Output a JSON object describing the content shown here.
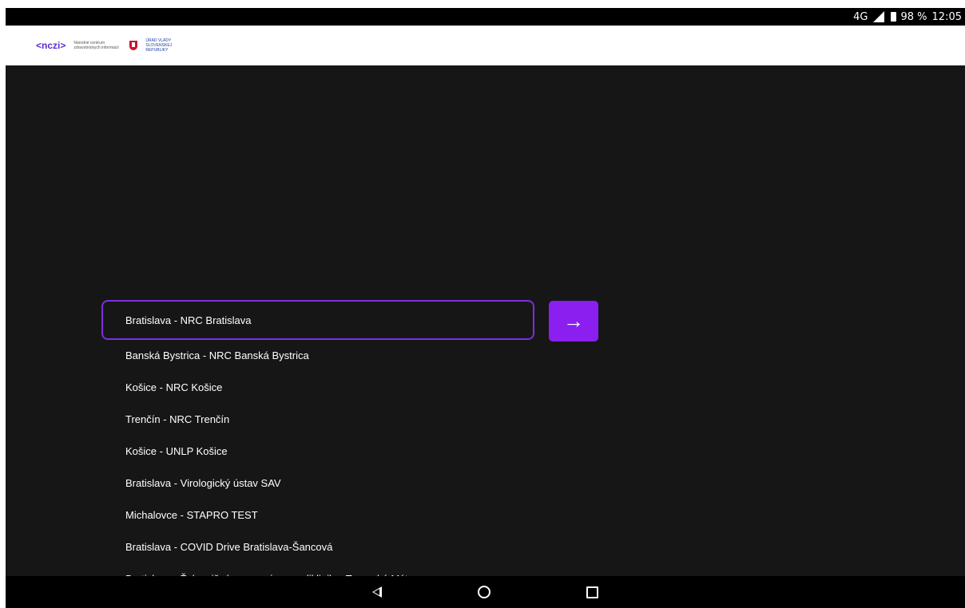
{
  "status_bar": {
    "network": "4G",
    "battery": "98 %",
    "time": "12:05"
  },
  "header": {
    "nczi_logo": "<nczi>",
    "nczi_subtitle": "Národné centrum zdravotníckych informácií",
    "gov_text": "ÚRAD VLÁDY SLOVENSKEJ REPUBLIKY"
  },
  "form": {
    "selected": "Bratislava - NRC Bratislava",
    "options": [
      "Banská Bystrica - NRC Banská Bystrica",
      "Košice - NRC Košice",
      "Trenčín - NRC Trenčín",
      "Košice - UNLP Košice",
      "Bratislava - Virologický ústav SAV",
      "Michalovce - STAPRO TEST",
      "Bratislava - COVID Drive Bratislava-Šancová",
      "Bratislava - Železničná nemocnica a poliklinika, Trnavské Mýto"
    ],
    "submit_icon": "→"
  },
  "icons": {
    "submit": "arrow-right-icon",
    "back": "back-icon",
    "home": "home-icon",
    "recent": "recent-apps-icon"
  }
}
